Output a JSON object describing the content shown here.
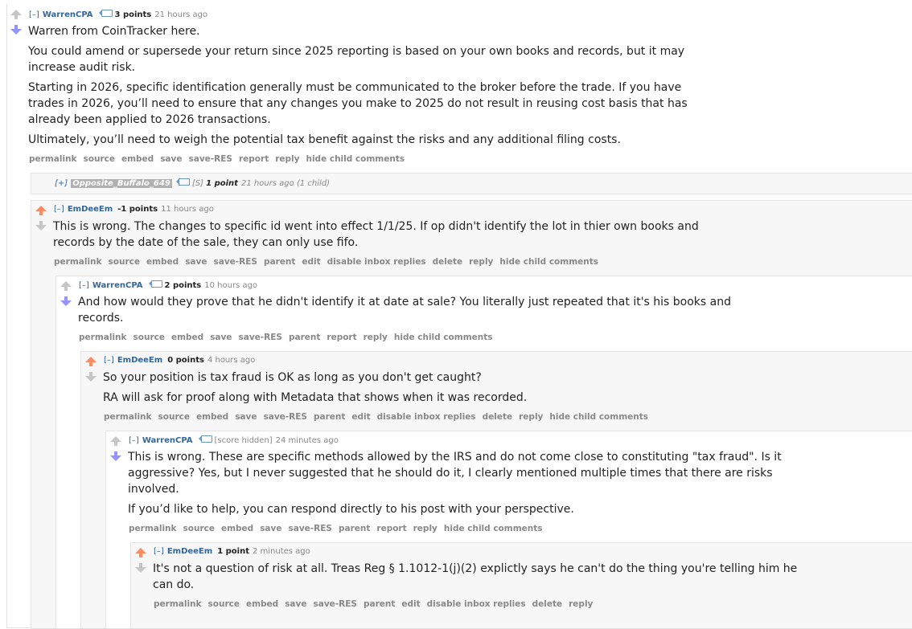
{
  "comments": [
    {
      "expander": "[–]",
      "author": "WarrenCPA",
      "score": "3 points",
      "time": "21 hours ago",
      "paragraphs": [
        "Warren from CoinTracker here.",
        "You could amend or supersede your return since 2025 reporting is based on your own books and records, but it may increase audit risk.",
        "Starting in 2026, specific identification generally must be communicated to the broker before the trade. If you have trades in 2026, you’ll need to ensure that any changes you make to 2025 do not result in reusing cost basis that has already been applied to 2026 transactions.",
        "Ultimately, you’ll need to weigh the potential tax benefit against the risks and any additional filing costs."
      ],
      "buttons": [
        "permalink",
        "source",
        "embed",
        "save",
        "save-RES",
        "report",
        "reply",
        "hide child comments"
      ]
    },
    {
      "expander": "[+]",
      "author": "Opposite_Buffalo_649",
      "flair_text": "[S]",
      "score": "1 point",
      "time": "21 hours ago",
      "children": "(1 child)"
    },
    {
      "expander": "[–]",
      "author": "EmDeeEm",
      "score": "-1 points",
      "time": "11 hours ago",
      "paragraphs": [
        "This is wrong. The changes to specific id went into effect 1/1/25. If op didn't identify the lot in thier own books and records by the date of the sale, they can only use fifo."
      ],
      "buttons": [
        "permalink",
        "source",
        "embed",
        "save",
        "save-RES",
        "parent",
        "edit",
        "disable inbox replies",
        "delete",
        "reply",
        "hide child comments"
      ]
    },
    {
      "expander": "[–]",
      "author": "WarrenCPA",
      "score": "2 points",
      "time": "10 hours ago",
      "paragraphs": [
        "And how would they prove that he didn't identify it at date at sale? You literally just repeated that it's his books and records."
      ],
      "buttons": [
        "permalink",
        "source",
        "embed",
        "save",
        "save-RES",
        "parent",
        "report",
        "reply",
        "hide child comments"
      ]
    },
    {
      "expander": "[–]",
      "author": "EmDeeEm",
      "score": "0 points",
      "time": "4 hours ago",
      "paragraphs": [
        "So your position is tax fraud is OK as long as you don't get caught?",
        "RA will ask for proof along with Metadata that shows when it was recorded."
      ],
      "buttons": [
        "permalink",
        "source",
        "embed",
        "save",
        "save-RES",
        "parent",
        "edit",
        "disable inbox replies",
        "delete",
        "reply",
        "hide child comments"
      ]
    },
    {
      "expander": "[–]",
      "author": "WarrenCPA",
      "score": "[score hidden]",
      "time": "24 minutes ago",
      "paragraphs": [
        "This is wrong. These are specific methods allowed by the IRS and do not come close to constituting \"tax fraud\". Is it aggressive? Yes, but I never suggested that he should do it, I clearly mentioned multiple times that there are risks involved.",
        "If you’d like to help, you can respond directly to his post with your perspective."
      ],
      "buttons": [
        "permalink",
        "source",
        "embed",
        "save",
        "save-RES",
        "parent",
        "report",
        "reply",
        "hide child comments"
      ]
    },
    {
      "expander": "[–]",
      "author": "EmDeeEm",
      "score": "1 point",
      "time": "2 minutes ago",
      "paragraphs": [
        "It's not a question of risk at all. Treas Reg § 1.1012-1(j)(2) explictly says he can't do the thing you're telling him he can do."
      ],
      "buttons": [
        "permalink",
        "source",
        "embed",
        "save",
        "save-RES",
        "parent",
        "edit",
        "disable inbox replies",
        "delete",
        "reply"
      ]
    }
  ],
  "colors": {
    "upvote": "#ff8b60",
    "downvote": "#9494ff",
    "author": "#336699",
    "muted": "#888888"
  }
}
